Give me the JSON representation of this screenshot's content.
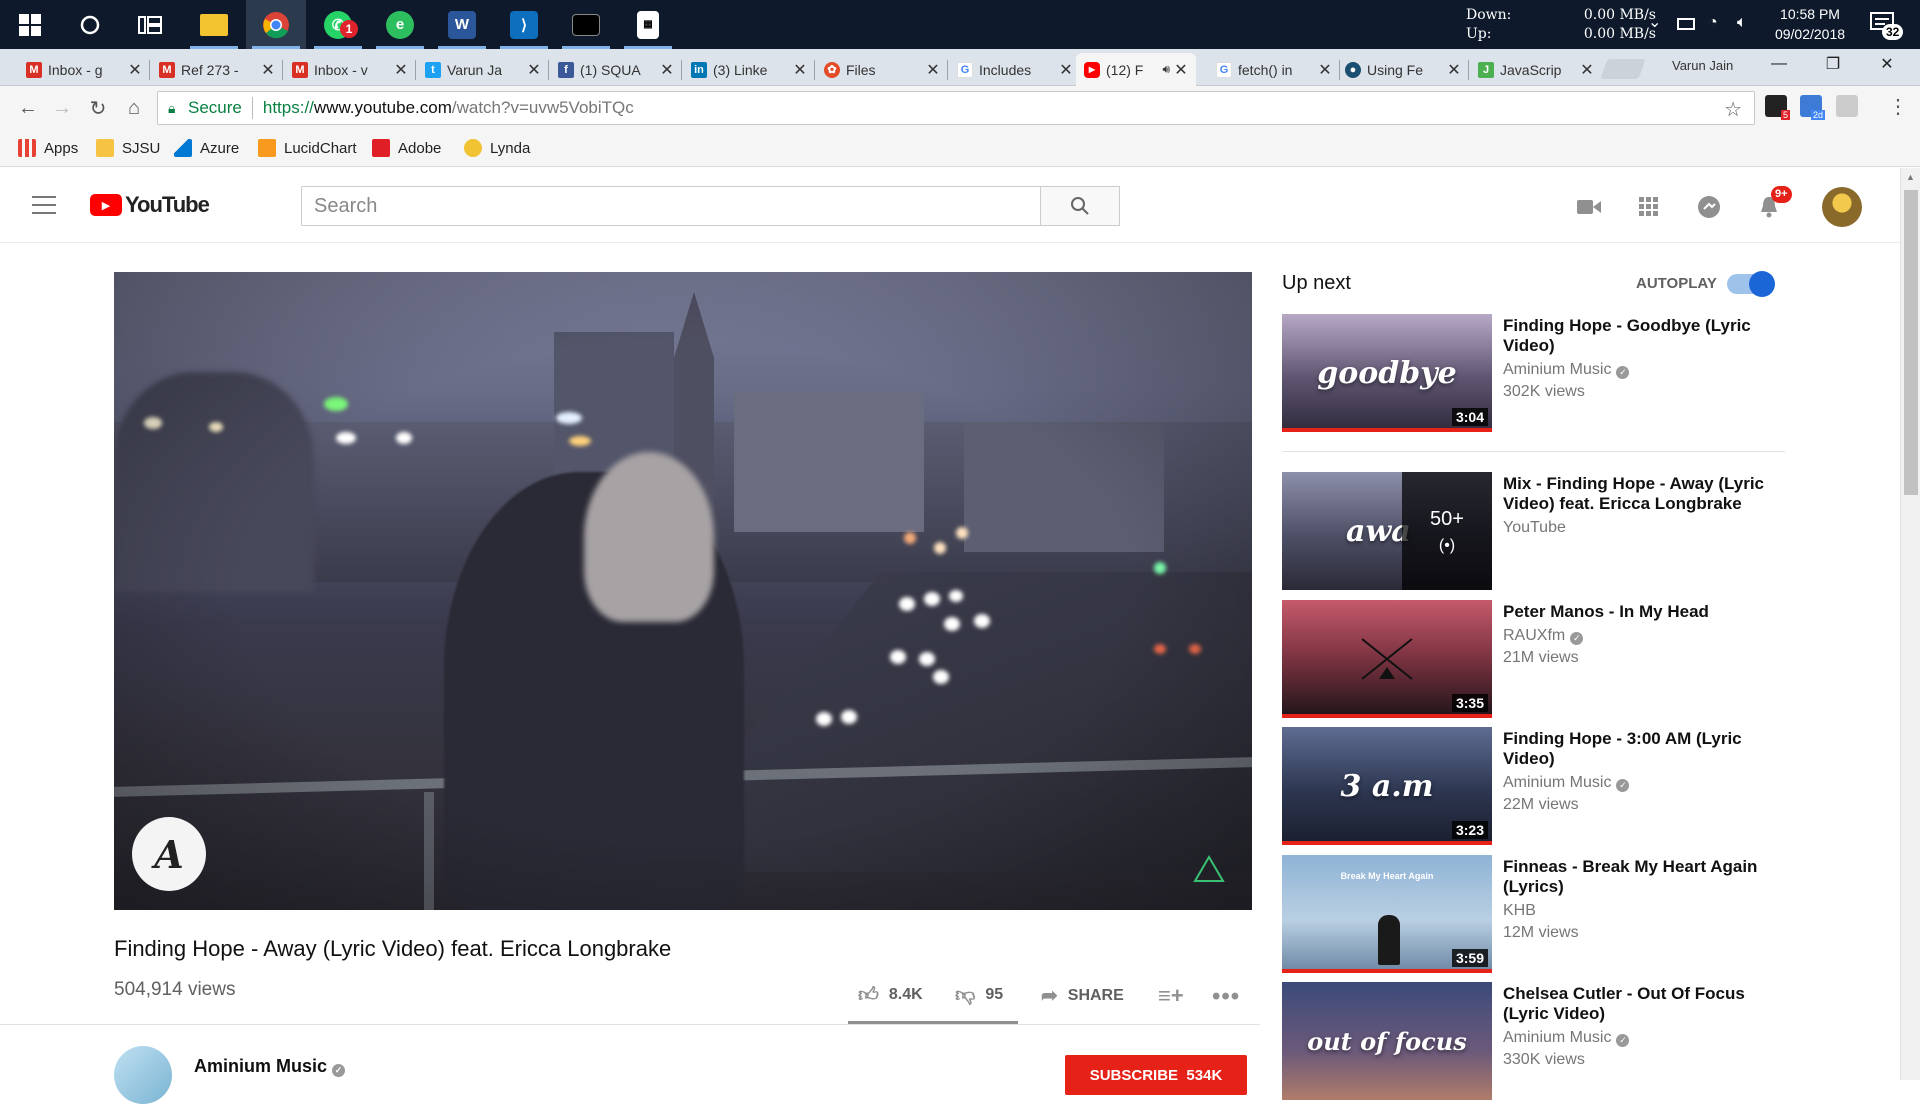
{
  "taskbar": {
    "network": {
      "down_label": "Down:",
      "up_label": "Up:",
      "down_value": "0.00 MB/s",
      "up_value": "0.00 MB/s"
    },
    "clock": {
      "time": "10:58 PM",
      "date": "09/02/2018"
    },
    "notification_count": "32",
    "whatsapp_badge": "1",
    "apps": [
      "start-menu",
      "cortana",
      "task-view",
      "file-explorer",
      "chrome",
      "whatsapp",
      "evernote",
      "word",
      "vscode",
      "terminal",
      "calculator"
    ]
  },
  "browser": {
    "profile_name": "Varun Jain",
    "tabs": [
      {
        "title": "Inbox - g",
        "favicon": "gmail-icon",
        "color": "#d93025"
      },
      {
        "title": "Ref 273 -",
        "favicon": "gmail-icon",
        "color": "#d93025"
      },
      {
        "title": "Inbox - v",
        "favicon": "gmail-icon",
        "color": "#d93025"
      },
      {
        "title": "Varun Ja",
        "favicon": "twitter-icon",
        "color": "#1da1f2"
      },
      {
        "title": "(1) SQUA",
        "favicon": "facebook-icon",
        "color": "#3b5998"
      },
      {
        "title": "(3) Linke",
        "favicon": "linkedin-icon",
        "color": "#0077b5"
      },
      {
        "title": "Files",
        "favicon": "files-icon",
        "color": "#e34c26"
      },
      {
        "title": "Includes",
        "favicon": "google-icon",
        "color": "#4285f4"
      },
      {
        "title": "(12) F",
        "favicon": "youtube-icon",
        "color": "#ff0000",
        "active": true
      },
      {
        "title": "fetch() in",
        "favicon": "google-icon",
        "color": "#4285f4"
      },
      {
        "title": "Using Fe",
        "favicon": "mdn-icon",
        "color": "#1b4f72"
      },
      {
        "title": "JavaScrip",
        "favicon": "js-icon",
        "color": "#4caf50"
      }
    ],
    "omnibox": {
      "secure_label": "Secure",
      "scheme": "https://",
      "host": "www.youtube.com",
      "path": "/watch?v=uvw5VobiTQc"
    },
    "extension_badges": {
      "ext1": "5",
      "ext2": "2d"
    },
    "bookmarks": [
      {
        "label": "Apps",
        "icon": "apps-grid-icon",
        "color": "#e94235"
      },
      {
        "label": "SJSU",
        "icon": "folder-icon",
        "color": "#f6c343"
      },
      {
        "label": "Azure",
        "icon": "azure-icon",
        "color": "#0078d4"
      },
      {
        "label": "LucidChart",
        "icon": "lucidchart-icon",
        "color": "#f79a1e"
      },
      {
        "label": "Adobe",
        "icon": "adobe-icon",
        "color": "#e01e26"
      },
      {
        "label": "Lynda",
        "icon": "lynda-icon",
        "color": "#f1c232"
      }
    ]
  },
  "youtube": {
    "logo_text": "YouTube",
    "search_placeholder": "Search",
    "notification_badge": "9+",
    "video": {
      "title": "Finding Hope - Away (Lyric Video) feat. Ericca Longbrake",
      "views": "504,914 views",
      "likes": "8.4K",
      "dislikes": "95",
      "share_label": "SHARE",
      "channel": "Aminium Music",
      "subscribe_label": "SUBSCRIBE",
      "subscriber_count": "534K"
    },
    "up_next": {
      "label": "Up next",
      "autoplay_label": "AUTOPLAY",
      "autoplay_on": true,
      "items": [
        {
          "title": "Finding Hope - Goodbye (Lyric Video)",
          "channel": "Aminium Music",
          "verified": true,
          "views": "302K views",
          "duration": "3:04",
          "thumb_text": "goodbye",
          "bg": "#5e5470"
        },
        {
          "title": "Mix - Finding Hope - Away (Lyric Video) feat. Ericca Longbrake",
          "channel": "YouTube",
          "verified": false,
          "views": "",
          "duration": "",
          "thumb_text": "awa",
          "mix_count": "50+",
          "bg": "#4d4f66"
        },
        {
          "title": "Peter Manos - In My Head",
          "channel": "RAUXfm",
          "verified": true,
          "views": "21M views",
          "duration": "3:35",
          "thumb_text": "",
          "bg": "#7a3240"
        },
        {
          "title": "Finding Hope - 3:00 AM (Lyric Video)",
          "channel": "Aminium Music",
          "verified": true,
          "views": "22M views",
          "duration": "3:23",
          "thumb_text": "3 a.m",
          "bg": "#2d3650"
        },
        {
          "title": "Finneas - Break My Heart Again (Lyrics)",
          "channel": "KHB",
          "verified": false,
          "views": "12M views",
          "duration": "3:59",
          "thumb_text": "Break My Heart Again",
          "bg": "#8fb3d6"
        },
        {
          "title": "Chelsea Cutler - Out Of Focus (Lyric Video)",
          "channel": "Aminium Music",
          "verified": true,
          "views": "330K views",
          "duration": "",
          "thumb_text": "out of focus",
          "bg": "#3b4a7a"
        }
      ]
    }
  }
}
